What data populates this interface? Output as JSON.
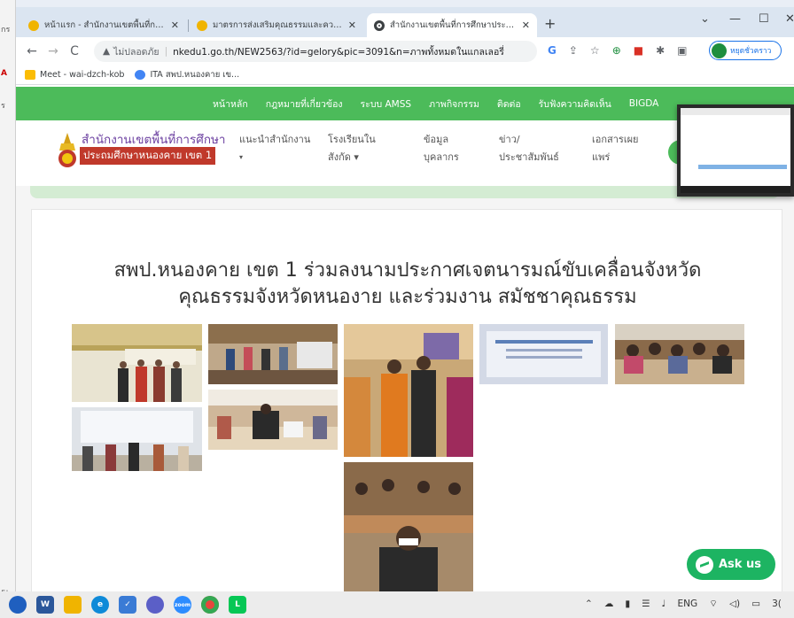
{
  "underlying": {
    "left_fragments": [
      "กร",
      "A",
      "ร",
      "5'"
    ]
  },
  "browser": {
    "tabs": [
      {
        "label": "หน้าแรก - สำนักงานเขตพื้นที่การศึกษ",
        "active": false
      },
      {
        "label": "มาตรการส่งเสริมคุณธรรมและความโปร่",
        "active": false
      },
      {
        "label": "สำนักงานเขตพื้นที่การศึกษาประถมศึก",
        "active": true
      }
    ],
    "new_tab": "+",
    "window_controls": [
      "⌄",
      "—",
      "☐",
      "✕"
    ],
    "address": {
      "insecure_label": "ไม่ปลอดภัย",
      "url": "nkedu1.go.th/NEW2563/?id=gelory&pic=3091&n=ภาพทั้งหมดในแกลเลอรี่"
    },
    "profile_label": "หยุดชั่วคราว",
    "bookmarks": [
      {
        "label": "Meet - wai-dzch-kob"
      },
      {
        "label": "ITA สพป.หนองคาย เข..."
      }
    ]
  },
  "site": {
    "topnav": [
      "หน้าหลัก",
      "กฎหมายที่เกี่ยวข้อง",
      "ระบบ AMSS",
      "ภาพกิจกรรม",
      "ติดต่อ",
      "รับฟังความคิดเห็น",
      "BIGDA"
    ],
    "logo": {
      "title": "สำนักงานเขตพื้นที่การศึกษา",
      "subtitle": "ประถมศึกษาหนองคาย เขต 1"
    },
    "menu": [
      {
        "line1": "แนะนำสำนักงาน",
        "line2": "▾"
      },
      {
        "line1": "โรงเรียนใน",
        "line2": "สังกัด ▾"
      },
      {
        "line1": "ข้อมูล",
        "line2": "บุคลากร"
      },
      {
        "line1": "ข่าว/",
        "line2": "ประชาสัมพันธ์"
      },
      {
        "line1": "เอกสารเผย",
        "line2": "แพร่"
      }
    ],
    "headline_line1": "สพป.หนองคาย เขต 1 ร่วมลงนามประกาศเจตนารมณ์ขับเคลื่อนจังหวัด",
    "headline_line2": "คุณธรรมจังหวัดหนองาย และร่วมงาน สมัชชาคุณธรรม",
    "ask_label": "Ask us"
  },
  "taskbar": {
    "apps": [
      "start-icon",
      "word-icon",
      "file-explorer-icon",
      "edge-icon",
      "todo-icon",
      "photos-icon",
      "zoom-icon",
      "chrome-icon",
      "line-icon"
    ],
    "tray_lang": "ENG",
    "clock_fragment": "3("
  },
  "colors": {
    "site_green": "#4cbb5a",
    "logo_red": "#c0392b",
    "logo_purple": "#6b3fa0",
    "ask_green": "#1db462",
    "tabbar": "#dbe5f1"
  }
}
